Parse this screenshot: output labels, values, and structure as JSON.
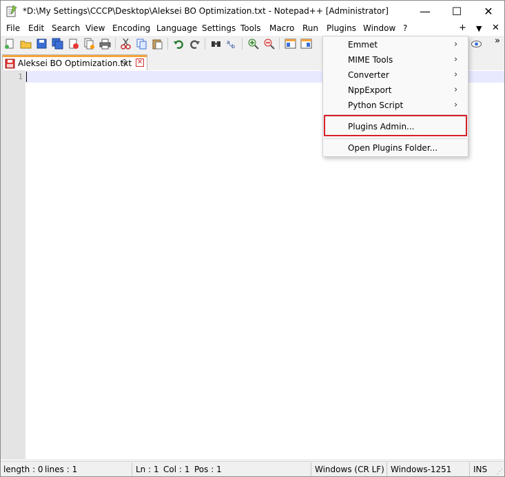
{
  "titlebar": {
    "title": "*D:\\My Settings\\CCCP\\Desktop\\Aleksei BO Optimization.txt - Notepad++ [Administrator]",
    "minimize_glyph": "—",
    "maximize_glyph": "☐",
    "close_glyph": "✕"
  },
  "menubar": {
    "items": [
      "File",
      "Edit",
      "Search",
      "View",
      "Encoding",
      "Language",
      "Settings",
      "Tools",
      "Macro",
      "Run",
      "Plugins",
      "Window",
      "?"
    ],
    "right_plus": "+",
    "right_arrow": "▼",
    "right_close": "✕"
  },
  "toolbar": {
    "overflow_glyph": "»"
  },
  "tab": {
    "label": "Aleksei BO Optimization.txt",
    "pin_glyph": "⚲",
    "close_glyph": "✕"
  },
  "editor": {
    "line_number": "1"
  },
  "plugins_menu": {
    "items": [
      {
        "label": "Emmet",
        "submenu": true
      },
      {
        "label": "MIME Tools",
        "submenu": true
      },
      {
        "label": "Converter",
        "submenu": true
      },
      {
        "label": "NppExport",
        "submenu": true
      },
      {
        "label": "Python Script",
        "submenu": true
      },
      {
        "label": "Plugins Admin...",
        "submenu": false
      },
      {
        "label": "Open Plugins Folder...",
        "submenu": false
      }
    ],
    "arrow_glyph": "›",
    "highlight_color": "#d61f26"
  },
  "statusbar": {
    "length": "length : 0",
    "lines": "lines : 1",
    "ln": "Ln : 1",
    "col": "Col : 1",
    "pos": "Pos : 1",
    "eol": "Windows (CR LF)",
    "encoding": "Windows-1251",
    "mode": "INS"
  },
  "colors": {
    "tab_accent": "#f7a33a",
    "current_line": "#e8e8ff",
    "gutter": "#e4e4e4"
  }
}
